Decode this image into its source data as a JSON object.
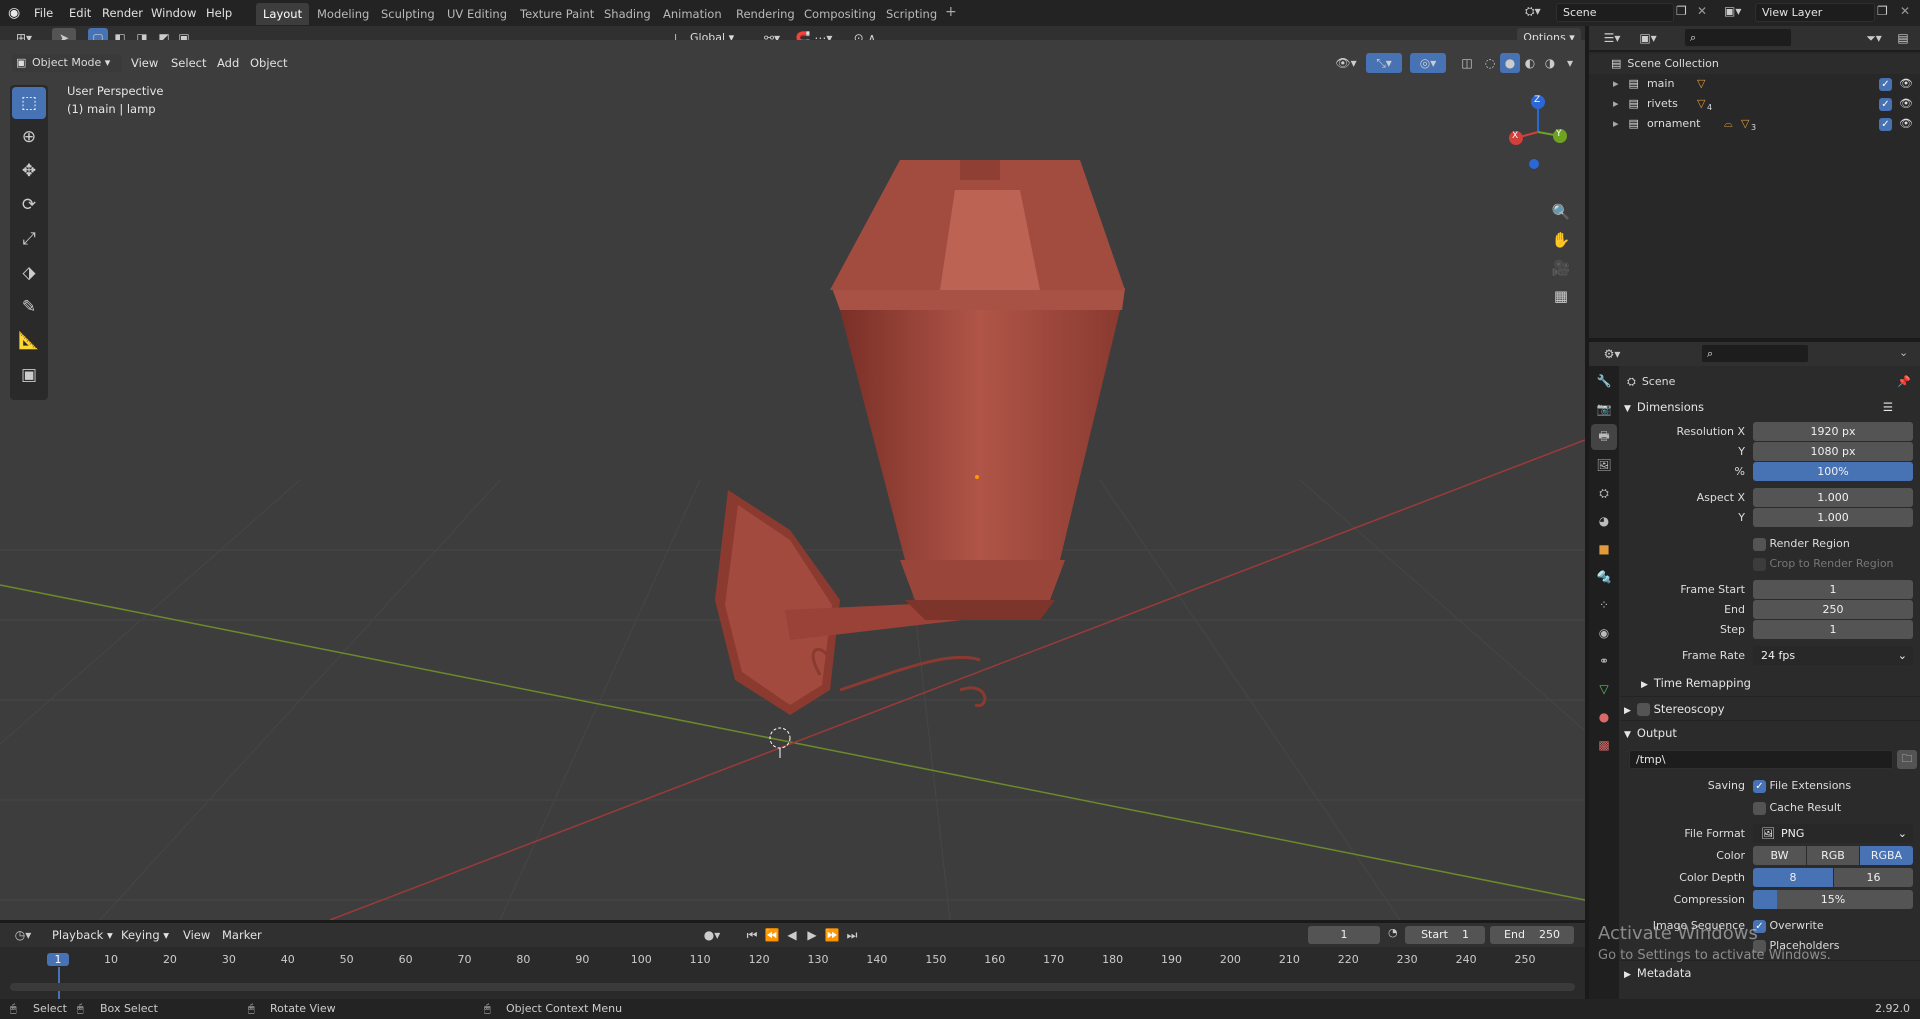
{
  "app": {
    "menus": [
      "File",
      "Edit",
      "Render",
      "Window",
      "Help"
    ]
  },
  "workspaces": [
    "Layout",
    "Modeling",
    "Sculpting",
    "UV Editing",
    "Texture Paint",
    "Shading",
    "Animation",
    "Rendering",
    "Compositing",
    "Scripting"
  ],
  "topright": {
    "scene": "Scene",
    "view_layer": "View Layer"
  },
  "viewport": {
    "mode": "Object Mode",
    "menus": [
      "View",
      "Select",
      "Add",
      "Object"
    ],
    "orientation": "Global",
    "options": "Options",
    "overlay_title": "User Perspective",
    "overlay_sub": "(1) main | lamp",
    "gizmo": {
      "x": "X",
      "y": "Y",
      "z": "Z"
    }
  },
  "outliner": {
    "root": "Scene Collection",
    "collections": [
      {
        "name": "main"
      },
      {
        "name": "rivets",
        "badge": "4"
      },
      {
        "name": "ornament",
        "badge": "3"
      }
    ]
  },
  "properties": {
    "header": "Scene",
    "dimensions": {
      "title": "Dimensions",
      "res_x_label": "Resolution X",
      "res_x": "1920 px",
      "res_y_label": "Y",
      "res_y": "1080 px",
      "pct_label": "%",
      "pct": "100%",
      "aspect_x_label": "Aspect X",
      "aspect_x": "1.000",
      "aspect_y_label": "Y",
      "aspect_y": "1.000",
      "render_region": "Render Region",
      "crop": "Crop to Render Region",
      "frame_start_label": "Frame Start",
      "frame_start": "1",
      "end_label": "End",
      "end": "250",
      "step_label": "Step",
      "step": "1",
      "frame_rate_label": "Frame Rate",
      "frame_rate": "24 fps",
      "time_remap": "Time Remapping"
    },
    "stereoscopy": "Stereoscopy",
    "output": {
      "title": "Output",
      "path": "/tmp\\",
      "saving_label": "Saving",
      "file_ext": "File Extensions",
      "cache": "Cache Result",
      "format_label": "File Format",
      "format": "PNG",
      "color_label": "Color",
      "color_opts": [
        "BW",
        "RGB",
        "RGBA"
      ],
      "depth_label": "Color Depth",
      "depth_opts": [
        "8",
        "16"
      ],
      "compression_label": "Compression",
      "compression": "15%",
      "compression_fraction": 0.15,
      "image_seq_label": "Image Sequence",
      "overwrite": "Overwrite",
      "placeholders": "Placeholders"
    },
    "metadata": "Metadata",
    "version": "2.92.0"
  },
  "timeline": {
    "menus": [
      "Playback",
      "Keying",
      "View",
      "Marker"
    ],
    "current_frame": "1",
    "start_label": "Start",
    "start": "1",
    "end_label": "End",
    "end": "250",
    "ruler": [
      "1",
      "10",
      "20",
      "30",
      "40",
      "50",
      "60",
      "70",
      "80",
      "90",
      "100",
      "110",
      "120",
      "130",
      "140",
      "150",
      "160",
      "170",
      "180",
      "190",
      "200",
      "210",
      "220",
      "230",
      "240",
      "250"
    ]
  },
  "status": {
    "select": "Select",
    "box": "Box Select",
    "rotate": "Rotate View",
    "ctx": "Object Context Menu"
  },
  "watermark": {
    "line1": "Activate Windows",
    "line2": "Go to Settings to activate Windows."
  },
  "colors": {
    "accent": "#4772b3",
    "lamp": "#a04a3e",
    "x_axis": "#9b3a3a",
    "y_axis": "#6c8a2a"
  }
}
